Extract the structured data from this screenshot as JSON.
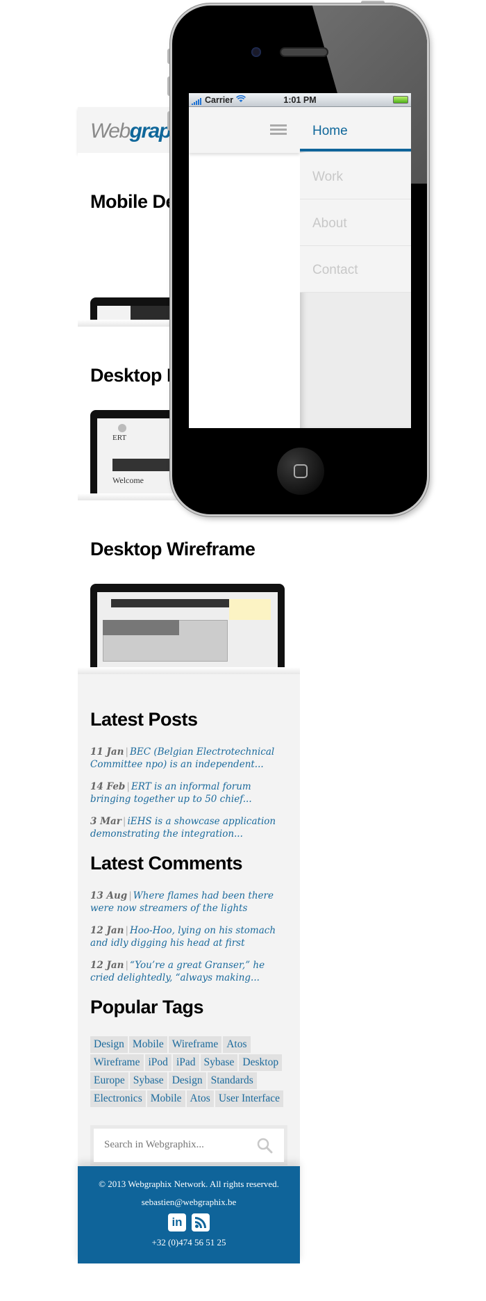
{
  "site": {
    "logo_light": "Web",
    "logo_bold": "graphix",
    "menu_icon": "hamburger-menu-icon"
  },
  "projects": [
    {
      "title": "Mobile Design"
    },
    {
      "title": "Desktop Design"
    },
    {
      "title": "Desktop Wireframe"
    }
  ],
  "latest_posts": {
    "title": "Latest Posts",
    "items": [
      {
        "date": "11 Jan",
        "text": "BEC (Belgian Electrotechnical Committee npo) is an independent..."
      },
      {
        "date": "14 Feb",
        "text": "ERT is an informal forum bringing together up to 50 chief..."
      },
      {
        "date": "3 Mar",
        "text": "iEHS is a showcase application demonstrating the integration..."
      }
    ]
  },
  "latest_comments": {
    "title": "Latest Comments",
    "items": [
      {
        "date": "13 Aug",
        "text": "Where flames had been there were now streamers of the lights"
      },
      {
        "date": "12 Jan",
        "text": "Hoo-Hoo, lying on his stomach and idly digging his head at first"
      },
      {
        "date": "12 Jan",
        "text": "“You’re a great Granser,” he cried delightedly, “always making..."
      }
    ]
  },
  "popular_tags": {
    "title": "Popular Tags",
    "items": [
      "Design",
      "Mobile",
      "Wireframe",
      "Atos",
      "Wireframe",
      "iPod",
      "iPad",
      "Sybase",
      "Desktop",
      "Europe",
      "Sybase",
      "Design",
      "Standards",
      "Electronics",
      "Mobile",
      "Atos",
      "User Interface"
    ]
  },
  "search": {
    "placeholder": "Search in Webgraphix...",
    "value": ""
  },
  "footer": {
    "copyright": "© 2013 Webgraphix Network. All rights reserved.",
    "email": "sebastien@webgraphix.be",
    "phone": "+32 (0)474 56 51 25",
    "socials": [
      {
        "name": "linkedin",
        "glyph": "in"
      },
      {
        "name": "rss",
        "glyph": "◣"
      }
    ]
  },
  "phone_mockup": {
    "status_bar": {
      "carrier": "Carrier",
      "time": "1:01 PM"
    },
    "nav": [
      {
        "label": "Home",
        "active": true
      },
      {
        "label": "Work",
        "active": false
      },
      {
        "label": "About",
        "active": false
      },
      {
        "label": "Contact",
        "active": false
      }
    ]
  },
  "colors": {
    "brand_blue": "#0f649a",
    "link_blue": "#1b6a9c",
    "panel_gray": "#f3f3f3"
  }
}
